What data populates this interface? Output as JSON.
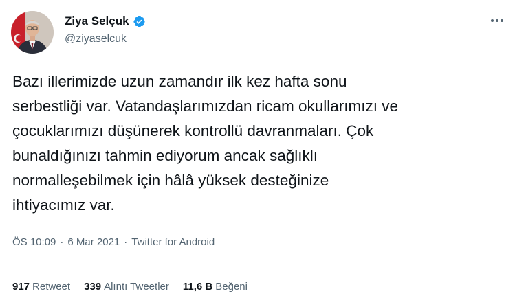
{
  "user": {
    "display_name": "Ziya Selçuk",
    "handle": "@ziyaselcuk",
    "verified_icon": "verified-badge-icon",
    "avatar_icon": "profile-photo"
  },
  "tweet": {
    "lines": [
      "Bazı illerimizde uzun zamandır ilk kez hafta sonu",
      "serbestliği var. Vatandaşlarımızdan ricam okullarımızı ve",
      "çocuklarımızı düşünerek kontrollü davranmaları. Çok",
      "bunaldığınızı tahmin ediyorum ancak sağlıklı",
      "normalleşebilmek için hâlâ yüksek desteğinize",
      "ihtiyacımız var."
    ]
  },
  "meta": {
    "time": "ÖS 10:09",
    "sep1": "·",
    "date": "6 Mar 2021",
    "sep2": "·",
    "source": "Twitter for Android"
  },
  "stats": {
    "retweets_count": "917",
    "retweets_label": "Retweet",
    "quotes_count": "339",
    "quotes_label": "Alıntı Tweetler",
    "likes_count": "11,6 B",
    "likes_label": "Beğeni"
  },
  "colors": {
    "verified_blue": "#1d9bf0",
    "secondary_text": "#536471",
    "primary_text": "#0f1419"
  }
}
